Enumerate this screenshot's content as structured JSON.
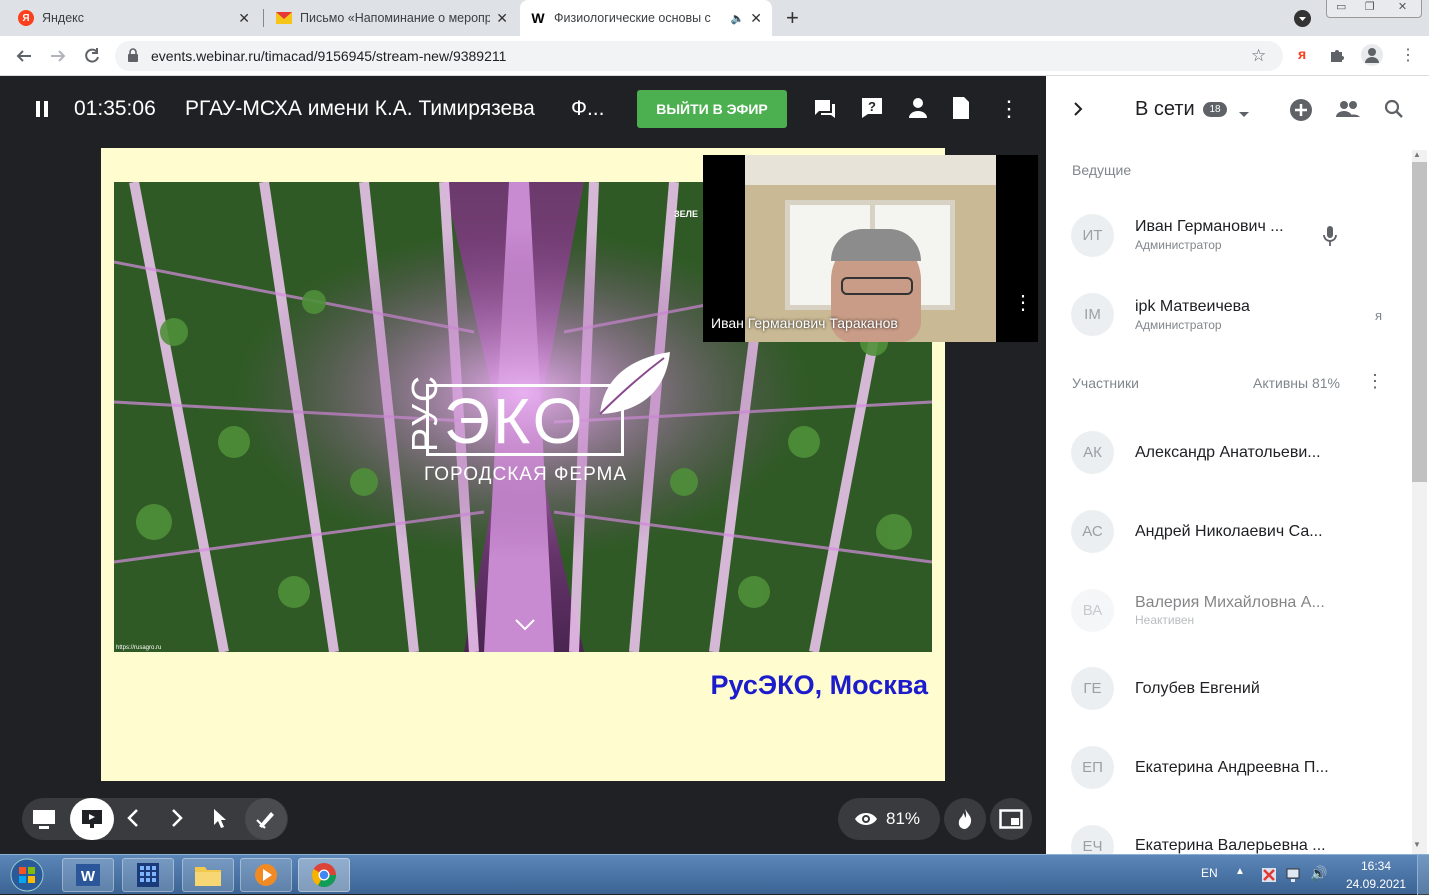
{
  "browser": {
    "tabs": [
      {
        "title": "Яндекс",
        "favicon": "yandex-icon"
      },
      {
        "title": "Письмо «Напоминание о мероприятии»",
        "favicon": "mail-icon"
      },
      {
        "title": "Физиологические основы с",
        "favicon": "webinar-icon"
      }
    ],
    "new_tab_label": "+",
    "url": "events.webinar.ru/timacad/9156945/stream-new/9389211"
  },
  "webinar": {
    "timer": "01:35:06",
    "title": "РГАУ-МСХА имени К.А. Тимирязева",
    "title_more": "Ф...",
    "go_live_label": "ВЫЙТИ В ЭФИР"
  },
  "slide": {
    "logo_side": "РУС",
    "logo_main": "ЭКО",
    "logo_sub": "ГОРОДСКАЯ ФЕРМА",
    "caption": "РусЭКО, Москва",
    "small_url": "https://rusagro.ru",
    "corner_text": "ЗЕЛЕ"
  },
  "camera": {
    "speaker_name": "Иван Германович Тараканов"
  },
  "controls": {
    "viewers_percent": "81%"
  },
  "sidebar": {
    "online_label": "В сети",
    "online_count": "18",
    "hosts_label": "Ведущие",
    "hosts": [
      {
        "initials": "ИТ",
        "name": "Иван Германович ...",
        "role": "Администратор"
      },
      {
        "initials": "IM",
        "name": "ipk Матвеичева",
        "role": "Администратор",
        "self": "я"
      }
    ],
    "participants_label": "Участники",
    "active_label": "Активны 81%",
    "participants": [
      {
        "initials": "АК",
        "name": "Александр Анатольеви...",
        "status": ""
      },
      {
        "initials": "АС",
        "name": "Андрей Николаевич Са...",
        "status": ""
      },
      {
        "initials": "ВА",
        "name": "Валерия Михайловна А...",
        "status": "Неактивен"
      },
      {
        "initials": "ГЕ",
        "name": "Голубев Евгений",
        "status": ""
      },
      {
        "initials": "ЕП",
        "name": "Екатерина Андреевна П...",
        "status": ""
      },
      {
        "initials": "ЕЧ",
        "name": "Екатерина Валерьевна ...",
        "status": ""
      }
    ]
  },
  "taskbar": {
    "lang": "EN",
    "time": "16:34",
    "date": "24.09.2021"
  },
  "colors": {
    "accent_green": "#4caf50",
    "caption_blue": "#1c1ccc",
    "slide_bg": "#fffdd0"
  }
}
